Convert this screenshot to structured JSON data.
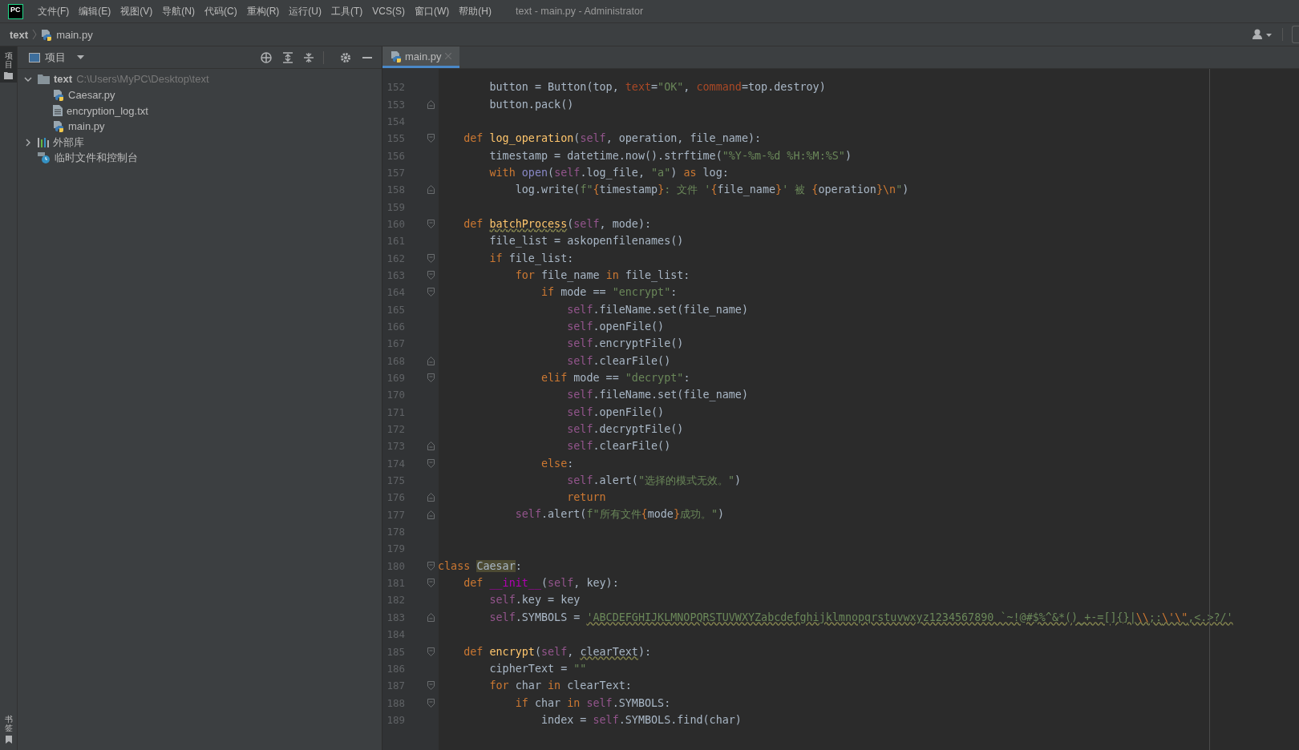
{
  "app_logo": "PC",
  "menu": [
    "文件(F)",
    "编辑(E)",
    "视图(V)",
    "导航(N)",
    "代码(C)",
    "重构(R)",
    "运行(U)",
    "工具(T)",
    "VCS(S)",
    "窗口(W)",
    "帮助(H)"
  ],
  "window_title": "text - main.py - Administrator",
  "breadcrumb": [
    "text",
    "main.py"
  ],
  "left_strip": {
    "top": "项目",
    "bottom": "书签"
  },
  "project_panel": {
    "title": "项目",
    "tree": [
      {
        "label": "text",
        "path": "C:\\Users\\MyPC\\Desktop\\text",
        "kind": "folder",
        "expanded": true,
        "children": [
          {
            "label": "Caesar.py",
            "kind": "python"
          },
          {
            "label": "encryption_log.txt",
            "kind": "text"
          },
          {
            "label": "main.py",
            "kind": "python"
          }
        ]
      },
      {
        "label": "外部库",
        "kind": "library",
        "expanded": false
      },
      {
        "label": "临时文件和控制台",
        "kind": "scratches"
      }
    ]
  },
  "editor_tabs": [
    {
      "label": "main.py",
      "selected": true
    }
  ],
  "code_lines": [
    {
      "number": "152",
      "tokens": [
        {
          "t": "        button = Button(top, ",
          "kind": "plain"
        },
        {
          "t": "text",
          "kind": "named-arg"
        },
        {
          "t": "=",
          "kind": "plain"
        },
        {
          "t": "\"OK\"",
          "kind": "string"
        },
        {
          "t": ", ",
          "kind": "plain"
        },
        {
          "t": "command",
          "kind": "named-arg"
        },
        {
          "t": "=top.destroy)",
          "kind": "plain"
        }
      ]
    },
    {
      "number": "153",
      "fold_marker": {
        "kind": "end"
      },
      "tokens": [
        {
          "t": "        button.pack()",
          "kind": "plain"
        }
      ]
    },
    {
      "number": "154"
    },
    {
      "number": "155",
      "fold_marker": {
        "kind": "start"
      },
      "tokens": [
        {
          "t": "    def ",
          "kind": "keyword"
        },
        {
          "t": "log_operation",
          "kind": "function"
        },
        {
          "t": "(",
          "kind": "plain"
        },
        {
          "t": "self",
          "kind": "self"
        },
        {
          "t": ", operation, file_name):",
          "kind": "plain"
        }
      ]
    },
    {
      "number": "156",
      "tokens": [
        {
          "t": "        timestamp = datetime.now().strftime(",
          "kind": "plain"
        },
        {
          "t": "\"%Y-%m-%d %H:%M:%S\"",
          "kind": "string"
        },
        {
          "t": ")",
          "kind": "plain"
        }
      ]
    },
    {
      "number": "157",
      "tokens": [
        {
          "t": "        with ",
          "kind": "keyword"
        },
        {
          "t": "open",
          "kind": "builtin"
        },
        {
          "t": "(",
          "kind": "plain"
        },
        {
          "t": "self",
          "kind": "self"
        },
        {
          "t": ".log_file, ",
          "kind": "plain"
        },
        {
          "t": "\"a\"",
          "kind": "string"
        },
        {
          "t": ") ",
          "kind": "plain"
        },
        {
          "t": "as",
          "kind": "keyword"
        },
        {
          "t": " log:",
          "kind": "plain"
        }
      ]
    },
    {
      "number": "158",
      "fold_marker": {
        "kind": "end"
      },
      "tokens": [
        {
          "t": "            log.write(",
          "kind": "plain"
        },
        {
          "t": "f\"",
          "kind": "string"
        },
        {
          "t": "{",
          "kind": "brace"
        },
        {
          "t": "timestamp",
          "kind": "plain"
        },
        {
          "t": "}",
          "kind": "brace"
        },
        {
          "t": ": 文件 '",
          "kind": "string"
        },
        {
          "t": "{",
          "kind": "brace"
        },
        {
          "t": "file_name",
          "kind": "plain"
        },
        {
          "t": "}",
          "kind": "brace"
        },
        {
          "t": "' 被 ",
          "kind": "string"
        },
        {
          "t": "{",
          "kind": "brace"
        },
        {
          "t": "operation",
          "kind": "plain"
        },
        {
          "t": "}",
          "kind": "brace"
        },
        {
          "t": "\\n",
          "kind": "brace"
        },
        {
          "t": "\"",
          "kind": "string"
        },
        {
          "t": ")",
          "kind": "plain"
        }
      ]
    },
    {
      "number": "159"
    },
    {
      "number": "160",
      "fold_marker": {
        "kind": "start"
      },
      "tokens": [
        {
          "t": "    def ",
          "kind": "keyword"
        },
        {
          "t": "batchProcess",
          "kind": "function-warn"
        },
        {
          "t": "(",
          "kind": "plain"
        },
        {
          "t": "self",
          "kind": "self"
        },
        {
          "t": ", mode):",
          "kind": "plain"
        }
      ]
    },
    {
      "number": "161",
      "tokens": [
        {
          "t": "        file_list = askopenfilenames()",
          "kind": "plain"
        }
      ]
    },
    {
      "number": "162",
      "fold_marker": {
        "kind": "start"
      },
      "tokens": [
        {
          "t": "        if",
          "kind": "keyword"
        },
        {
          "t": " file_list:",
          "kind": "plain"
        }
      ]
    },
    {
      "number": "163",
      "fold_marker": {
        "kind": "start"
      },
      "tokens": [
        {
          "t": "            for",
          "kind": "keyword"
        },
        {
          "t": " file_name ",
          "kind": "plain"
        },
        {
          "t": "in",
          "kind": "keyword"
        },
        {
          "t": " file_list:",
          "kind": "plain"
        }
      ]
    },
    {
      "number": "164",
      "fold_marker": {
        "kind": "start"
      },
      "tokens": [
        {
          "t": "                if",
          "kind": "keyword"
        },
        {
          "t": " mode == ",
          "kind": "plain"
        },
        {
          "t": "\"encrypt\"",
          "kind": "string"
        },
        {
          "t": ":",
          "kind": "plain"
        }
      ]
    },
    {
      "number": "165",
      "tokens": [
        {
          "t": "                    self",
          "kind": "self"
        },
        {
          "t": ".fileName.set(file_name)",
          "kind": "plain"
        }
      ]
    },
    {
      "number": "166",
      "tokens": [
        {
          "t": "                    self",
          "kind": "self"
        },
        {
          "t": ".openFile()",
          "kind": "plain"
        }
      ]
    },
    {
      "number": "167",
      "tokens": [
        {
          "t": "                    self",
          "kind": "self"
        },
        {
          "t": ".encryptFile()",
          "kind": "plain"
        }
      ]
    },
    {
      "number": "168",
      "fold_marker": {
        "kind": "end"
      },
      "tokens": [
        {
          "t": "                    self",
          "kind": "self"
        },
        {
          "t": ".clearFile()",
          "kind": "plain"
        }
      ]
    },
    {
      "number": "169",
      "fold_marker": {
        "kind": "start"
      },
      "tokens": [
        {
          "t": "                elif",
          "kind": "keyword"
        },
        {
          "t": " mode == ",
          "kind": "plain"
        },
        {
          "t": "\"decrypt\"",
          "kind": "string"
        },
        {
          "t": ":",
          "kind": "plain"
        }
      ]
    },
    {
      "number": "170",
      "tokens": [
        {
          "t": "                    self",
          "kind": "self"
        },
        {
          "t": ".fileName.set(file_name)",
          "kind": "plain"
        }
      ]
    },
    {
      "number": "171",
      "tokens": [
        {
          "t": "                    self",
          "kind": "self"
        },
        {
          "t": ".openFile()",
          "kind": "plain"
        }
      ]
    },
    {
      "number": "172",
      "tokens": [
        {
          "t": "                    self",
          "kind": "self"
        },
        {
          "t": ".decryptFile()",
          "kind": "plain"
        }
      ]
    },
    {
      "number": "173",
      "fold_marker": {
        "kind": "end"
      },
      "tokens": [
        {
          "t": "                    self",
          "kind": "self"
        },
        {
          "t": ".clearFile()",
          "kind": "plain"
        }
      ]
    },
    {
      "number": "174",
      "fold_marker": {
        "kind": "start"
      },
      "tokens": [
        {
          "t": "                else",
          "kind": "keyword"
        },
        {
          "t": ":",
          "kind": "plain"
        }
      ]
    },
    {
      "number": "175",
      "tokens": [
        {
          "t": "                    self",
          "kind": "self"
        },
        {
          "t": ".alert(",
          "kind": "plain"
        },
        {
          "t": "\"选择的模式无效。\"",
          "kind": "string"
        },
        {
          "t": ")",
          "kind": "plain"
        }
      ]
    },
    {
      "number": "176",
      "fold_marker": {
        "kind": "end"
      },
      "tokens": [
        {
          "t": "                    return",
          "kind": "keyword"
        }
      ]
    },
    {
      "number": "177",
      "fold_marker": {
        "kind": "end"
      },
      "tokens": [
        {
          "t": "            self",
          "kind": "self"
        },
        {
          "t": ".alert(",
          "kind": "plain"
        },
        {
          "t": "f\"所有文件",
          "kind": "string"
        },
        {
          "t": "{",
          "kind": "brace"
        },
        {
          "t": "mode",
          "kind": "plain"
        },
        {
          "t": "}",
          "kind": "brace"
        },
        {
          "t": "成功。\"",
          "kind": "string"
        },
        {
          "t": ")",
          "kind": "plain"
        }
      ]
    },
    {
      "number": "178"
    },
    {
      "number": "179"
    },
    {
      "number": "180",
      "fold_marker": {
        "kind": "start"
      },
      "tokens": [
        {
          "t": "class ",
          "kind": "keyword"
        },
        {
          "t": "Caesar",
          "kind": "highlight"
        },
        {
          "t": ":",
          "kind": "plain"
        }
      ]
    },
    {
      "number": "181",
      "fold_marker": {
        "kind": "start"
      },
      "tokens": [
        {
          "t": "    def ",
          "kind": "keyword"
        },
        {
          "t": "__init__",
          "kind": "magic"
        },
        {
          "t": "(",
          "kind": "plain"
        },
        {
          "t": "self",
          "kind": "self"
        },
        {
          "t": ", key):",
          "kind": "plain"
        }
      ]
    },
    {
      "number": "182",
      "tokens": [
        {
          "t": "        self",
          "kind": "self"
        },
        {
          "t": ".key = key",
          "kind": "plain"
        }
      ]
    },
    {
      "number": "183",
      "fold_marker": {
        "kind": "end"
      },
      "tokens": [
        {
          "t": "        self",
          "kind": "self"
        },
        {
          "t": ".SYMBOLS = ",
          "kind": "plain"
        },
        {
          "t": "'ABCDEFGHIJKLMNOPQRSTUVWXYZabcdefghijklmnopqrstuvwxyz1234567890 `~!@#$%^&*()_+-=[]{}|",
          "kind": "string-warn"
        },
        {
          "t": "\\\\",
          "kind": "escape-warn"
        },
        {
          "t": ";:",
          "kind": "string-warn"
        },
        {
          "t": "\\'\\\"",
          "kind": "escape-warn"
        },
        {
          "t": ",<.>?/'",
          "kind": "string-warn"
        }
      ]
    },
    {
      "number": "184"
    },
    {
      "number": "185",
      "fold_marker": {
        "kind": "start"
      },
      "tokens": [
        {
          "t": "    def ",
          "kind": "keyword"
        },
        {
          "t": "encrypt",
          "kind": "function"
        },
        {
          "t": "(",
          "kind": "plain"
        },
        {
          "t": "self",
          "kind": "self"
        },
        {
          "t": ", ",
          "kind": "plain"
        },
        {
          "t": "clearText",
          "kind": "plain-warn"
        },
        {
          "t": "):",
          "kind": "plain"
        }
      ]
    },
    {
      "number": "186",
      "tokens": [
        {
          "t": "        cipherText = ",
          "kind": "plain"
        },
        {
          "t": "\"\"",
          "kind": "string"
        }
      ]
    },
    {
      "number": "187",
      "fold_marker": {
        "kind": "start"
      },
      "tokens": [
        {
          "t": "        for",
          "kind": "keyword"
        },
        {
          "t": " char ",
          "kind": "plain"
        },
        {
          "t": "in",
          "kind": "keyword"
        },
        {
          "t": " clearText:",
          "kind": "plain"
        }
      ]
    },
    {
      "number": "188",
      "fold_marker": {
        "kind": "start"
      },
      "tokens": [
        {
          "t": "            if",
          "kind": "keyword"
        },
        {
          "t": " char ",
          "kind": "plain"
        },
        {
          "t": "in",
          "kind": "keyword"
        },
        {
          "t": " self",
          "kind": "self"
        },
        {
          "t": ".SYMBOLS:",
          "kind": "plain"
        }
      ]
    },
    {
      "number": "189",
      "tokens": [
        {
          "t": "                index = ",
          "kind": "plain"
        },
        {
          "t": "self",
          "kind": "self"
        },
        {
          "t": ".SYMBOLS.find(char)",
          "kind": "plain"
        }
      ]
    }
  ]
}
